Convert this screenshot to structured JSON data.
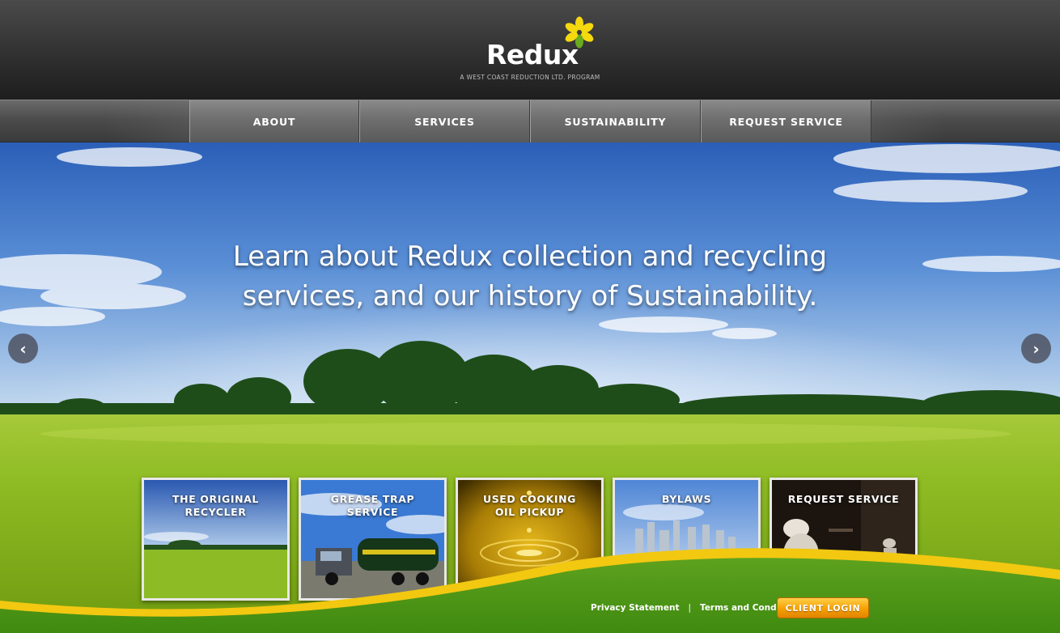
{
  "brand": {
    "name": "Redux",
    "tagline": "A WEST COAST REDUCTION LTD. PROGRAM",
    "logo_icon": "flower-icon",
    "colors": {
      "yellow": "#f5d90f",
      "green": "#6aaa1e"
    }
  },
  "nav": {
    "items": [
      {
        "label": "ABOUT"
      },
      {
        "label": "SERVICES"
      },
      {
        "label": "SUSTAINABILITY"
      },
      {
        "label": "REQUEST SERVICE"
      }
    ]
  },
  "hero": {
    "headline_line1": "Learn about Redux collection and recycling",
    "headline_line2": "services, and our history of Sustainability.",
    "prev_icon": "chevron-left-icon",
    "next_icon": "chevron-right-icon"
  },
  "tiles": [
    {
      "line1": "THE ORIGINAL",
      "line2": "RECYCLER"
    },
    {
      "line1": "GREASE TRAP",
      "line2": "SERVICE"
    },
    {
      "line1": "USED COOKING",
      "line2": "OIL PICKUP"
    },
    {
      "line1": "BYLAWS",
      "line2": ""
    },
    {
      "line1": "REQUEST SERVICE",
      "line2": ""
    }
  ],
  "footer": {
    "privacy": "Privacy Statement",
    "separator": "|",
    "terms": "Terms and Conditions",
    "login": "CLIENT LOGIN"
  }
}
